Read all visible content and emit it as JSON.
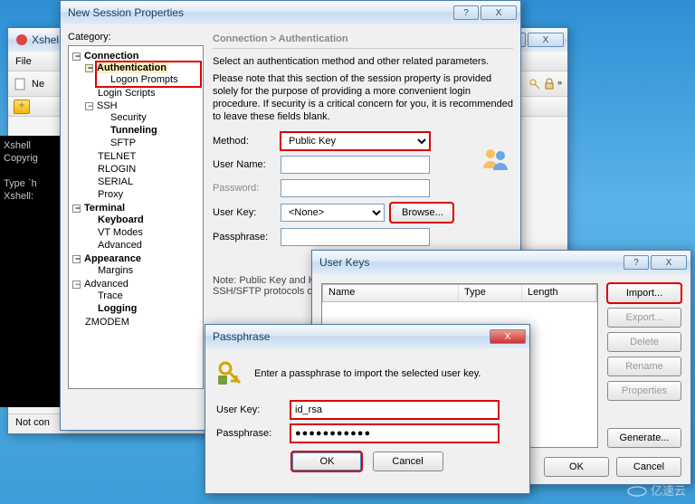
{
  "bg_xshell": {
    "title": "Xshel",
    "menu_file": "File",
    "tb_new": "Ne",
    "term_l1": "Xshell",
    "term_l2": "Copyrig",
    "term_l3": "Type `h",
    "term_l4": "Xshell:",
    "status": "Not con"
  },
  "session_tab": {
    "plus": "+"
  },
  "nsp": {
    "title": "New Session Properties",
    "category_label": "Category:",
    "breadcrumb": "Connection  >  Authentication",
    "desc1": "Select an authentication method and other related parameters.",
    "desc2": "Please note that this section of the session property is provided solely for the purpose of providing a more convenient login procedure. If security is a critical concern for you, it is recommended to leave these fields blank.",
    "method_label": "Method:",
    "method_value": "Public Key",
    "username_label": "User Name:",
    "password_label": "Password:",
    "userkey_label": "User Key:",
    "userkey_value": "<None>",
    "browse": "Browse...",
    "pass_label": "Passphrase:",
    "note": "Note: Public Key and Keyboard Interactive are available for SSH/SFTP protocols only."
  },
  "tree": {
    "connection": "Connection",
    "authentication": "Authentication",
    "logon_prompts": "Logon Prompts",
    "login_scripts": "Login Scripts",
    "ssh": "SSH",
    "security": "Security",
    "tunneling": "Tunneling",
    "sftp": "SFTP",
    "telnet": "TELNET",
    "rlogin": "RLOGIN",
    "serial": "SERIAL",
    "proxy": "Proxy",
    "terminal": "Terminal",
    "keyboard": "Keyboard",
    "vt": "VT Modes",
    "advanced": "Advanced",
    "appearance": "Appearance",
    "margins": "Margins",
    "adv2": "Advanced",
    "trace": "Trace",
    "logging": "Logging",
    "zmodem": "ZMODEM"
  },
  "uk": {
    "title": "User Keys",
    "col_name": "Name",
    "col_type": "Type",
    "col_length": "Length",
    "import": "Import...",
    "export": "Export...",
    "delete": "Delete",
    "rename": "Rename",
    "props": "Properties",
    "generate": "Generate...",
    "ok": "OK",
    "cancel": "Cancel"
  },
  "pp": {
    "title": "Passphrase",
    "msg": "Enter a passphrase to import the selected user key.",
    "userkey_label": "User Key:",
    "userkey_value": "id_rsa",
    "pass_label": "Passphrase:",
    "pass_value": "●●●●●●●●●●●",
    "ok": "OK",
    "cancel": "Cancel"
  }
}
